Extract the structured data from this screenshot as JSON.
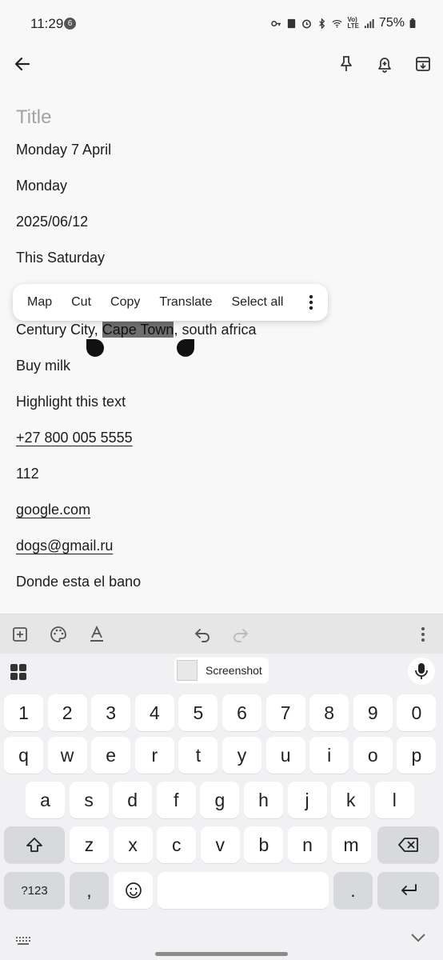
{
  "status": {
    "time": "11:29",
    "notification_count": "6",
    "battery": "75%"
  },
  "note": {
    "title_placeholder": "Title",
    "lines": [
      "Monday 7 April",
      "Monday",
      "2025/06/12",
      "This Saturday"
    ],
    "selected_line": {
      "before": "Century City, ",
      "selected": "Cape Town",
      "after": ", south africa"
    },
    "more_lines": [
      "Buy milk",
      "Highlight this text"
    ],
    "phone": "+27 800 005 5555",
    "number": "112",
    "website": "google.com",
    "email": "dogs@gmail.ru",
    "spanish": "Donde esta el bano"
  },
  "context_menu": {
    "items": [
      "Map",
      "Cut",
      "Copy",
      "Translate",
      "Select all"
    ]
  },
  "keyboard": {
    "clipboard_label": "Screenshot",
    "row_numbers": [
      "1",
      "2",
      "3",
      "4",
      "5",
      "6",
      "7",
      "8",
      "9",
      "0"
    ],
    "row1": [
      "q",
      "w",
      "e",
      "r",
      "t",
      "y",
      "u",
      "i",
      "o",
      "p"
    ],
    "row2": [
      "a",
      "s",
      "d",
      "f",
      "g",
      "h",
      "j",
      "k",
      "l"
    ],
    "row3": [
      "z",
      "x",
      "c",
      "v",
      "b",
      "n",
      "m"
    ],
    "symbols": "?123",
    "comma": ",",
    "period": "."
  }
}
